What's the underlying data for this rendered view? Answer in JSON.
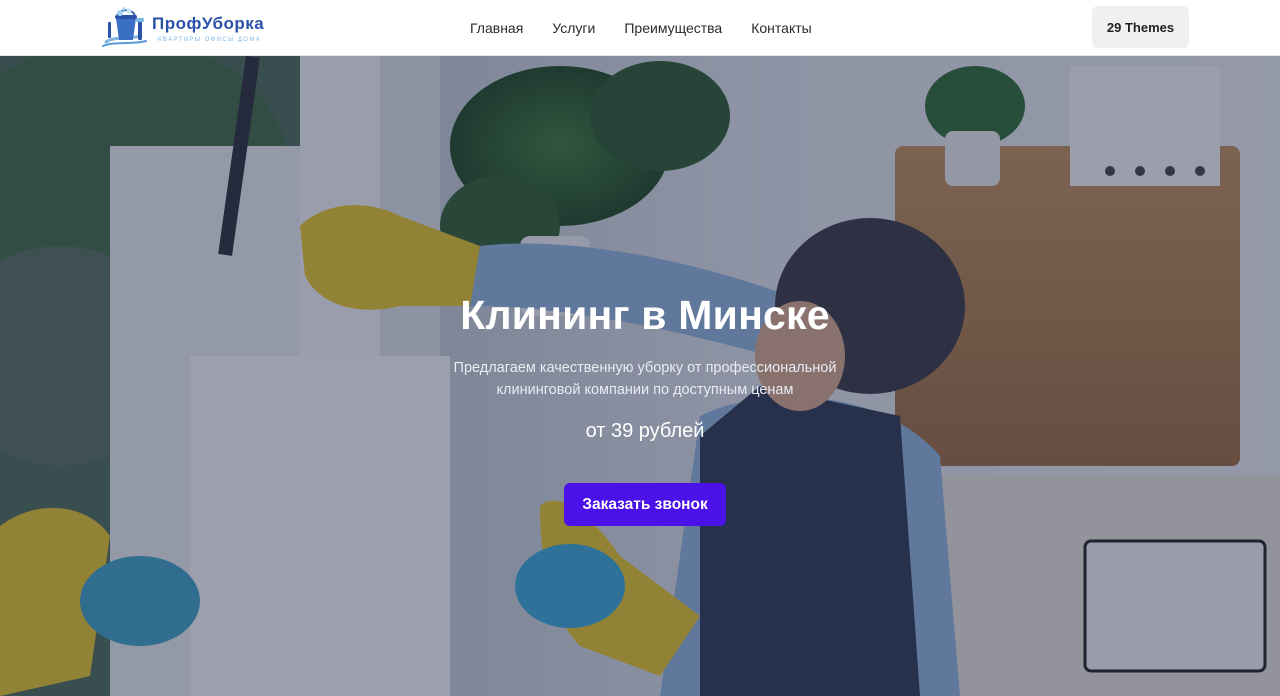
{
  "header": {
    "logo": {
      "title": "ПрофУборка",
      "subtitle": "квартиры офисы дома",
      "icon": "bucket-cleaning-icon"
    },
    "nav": [
      {
        "label": "Главная"
      },
      {
        "label": "Услуги"
      },
      {
        "label": "Преимущества"
      },
      {
        "label": "Контакты"
      }
    ],
    "themes_button": "29 Themes"
  },
  "hero": {
    "title": "Клининг в Минске",
    "description": "Предлагаем качественную уборку от профессиональной клининговой компании по доступным ценам",
    "price": "от 39 рублей",
    "cta_label": "Заказать звонок",
    "background": "cleaner-washing-window-photo"
  },
  "colors": {
    "accent": "#4a12e8",
    "logo_blue": "#2a52a8",
    "logo_light": "#7fb8e6",
    "overlay": "#1e2646"
  }
}
